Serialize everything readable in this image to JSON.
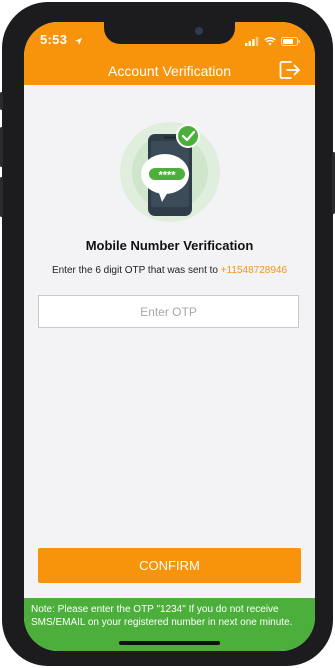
{
  "status_bar": {
    "time": "5:53",
    "location_icon": "location-arrow-icon",
    "signal_icon": "signal-bars-icon",
    "wifi_icon": "wifi-icon",
    "battery_icon": "battery-icon"
  },
  "header": {
    "title": "Account Verification",
    "logout_icon": "logout-icon",
    "background_color": "#f7940c"
  },
  "verification": {
    "illustration_icon": "phone-otp-check-icon",
    "otp_mask": "****",
    "title": "Mobile Number Verification",
    "subtitle_prefix": "Enter the 6 digit OTP that was sent to ",
    "phone_number": "+11548728946",
    "otp_placeholder": "Enter OTP",
    "otp_value": ""
  },
  "actions": {
    "confirm_label": "CONFIRM",
    "accent_color": "#f7940c"
  },
  "footer_note": {
    "text": "Note: Please enter the OTP \"1234\" If you do not receive SMS/EMAIL on your registered number in next one minute.",
    "background_color": "#4caf3c"
  }
}
